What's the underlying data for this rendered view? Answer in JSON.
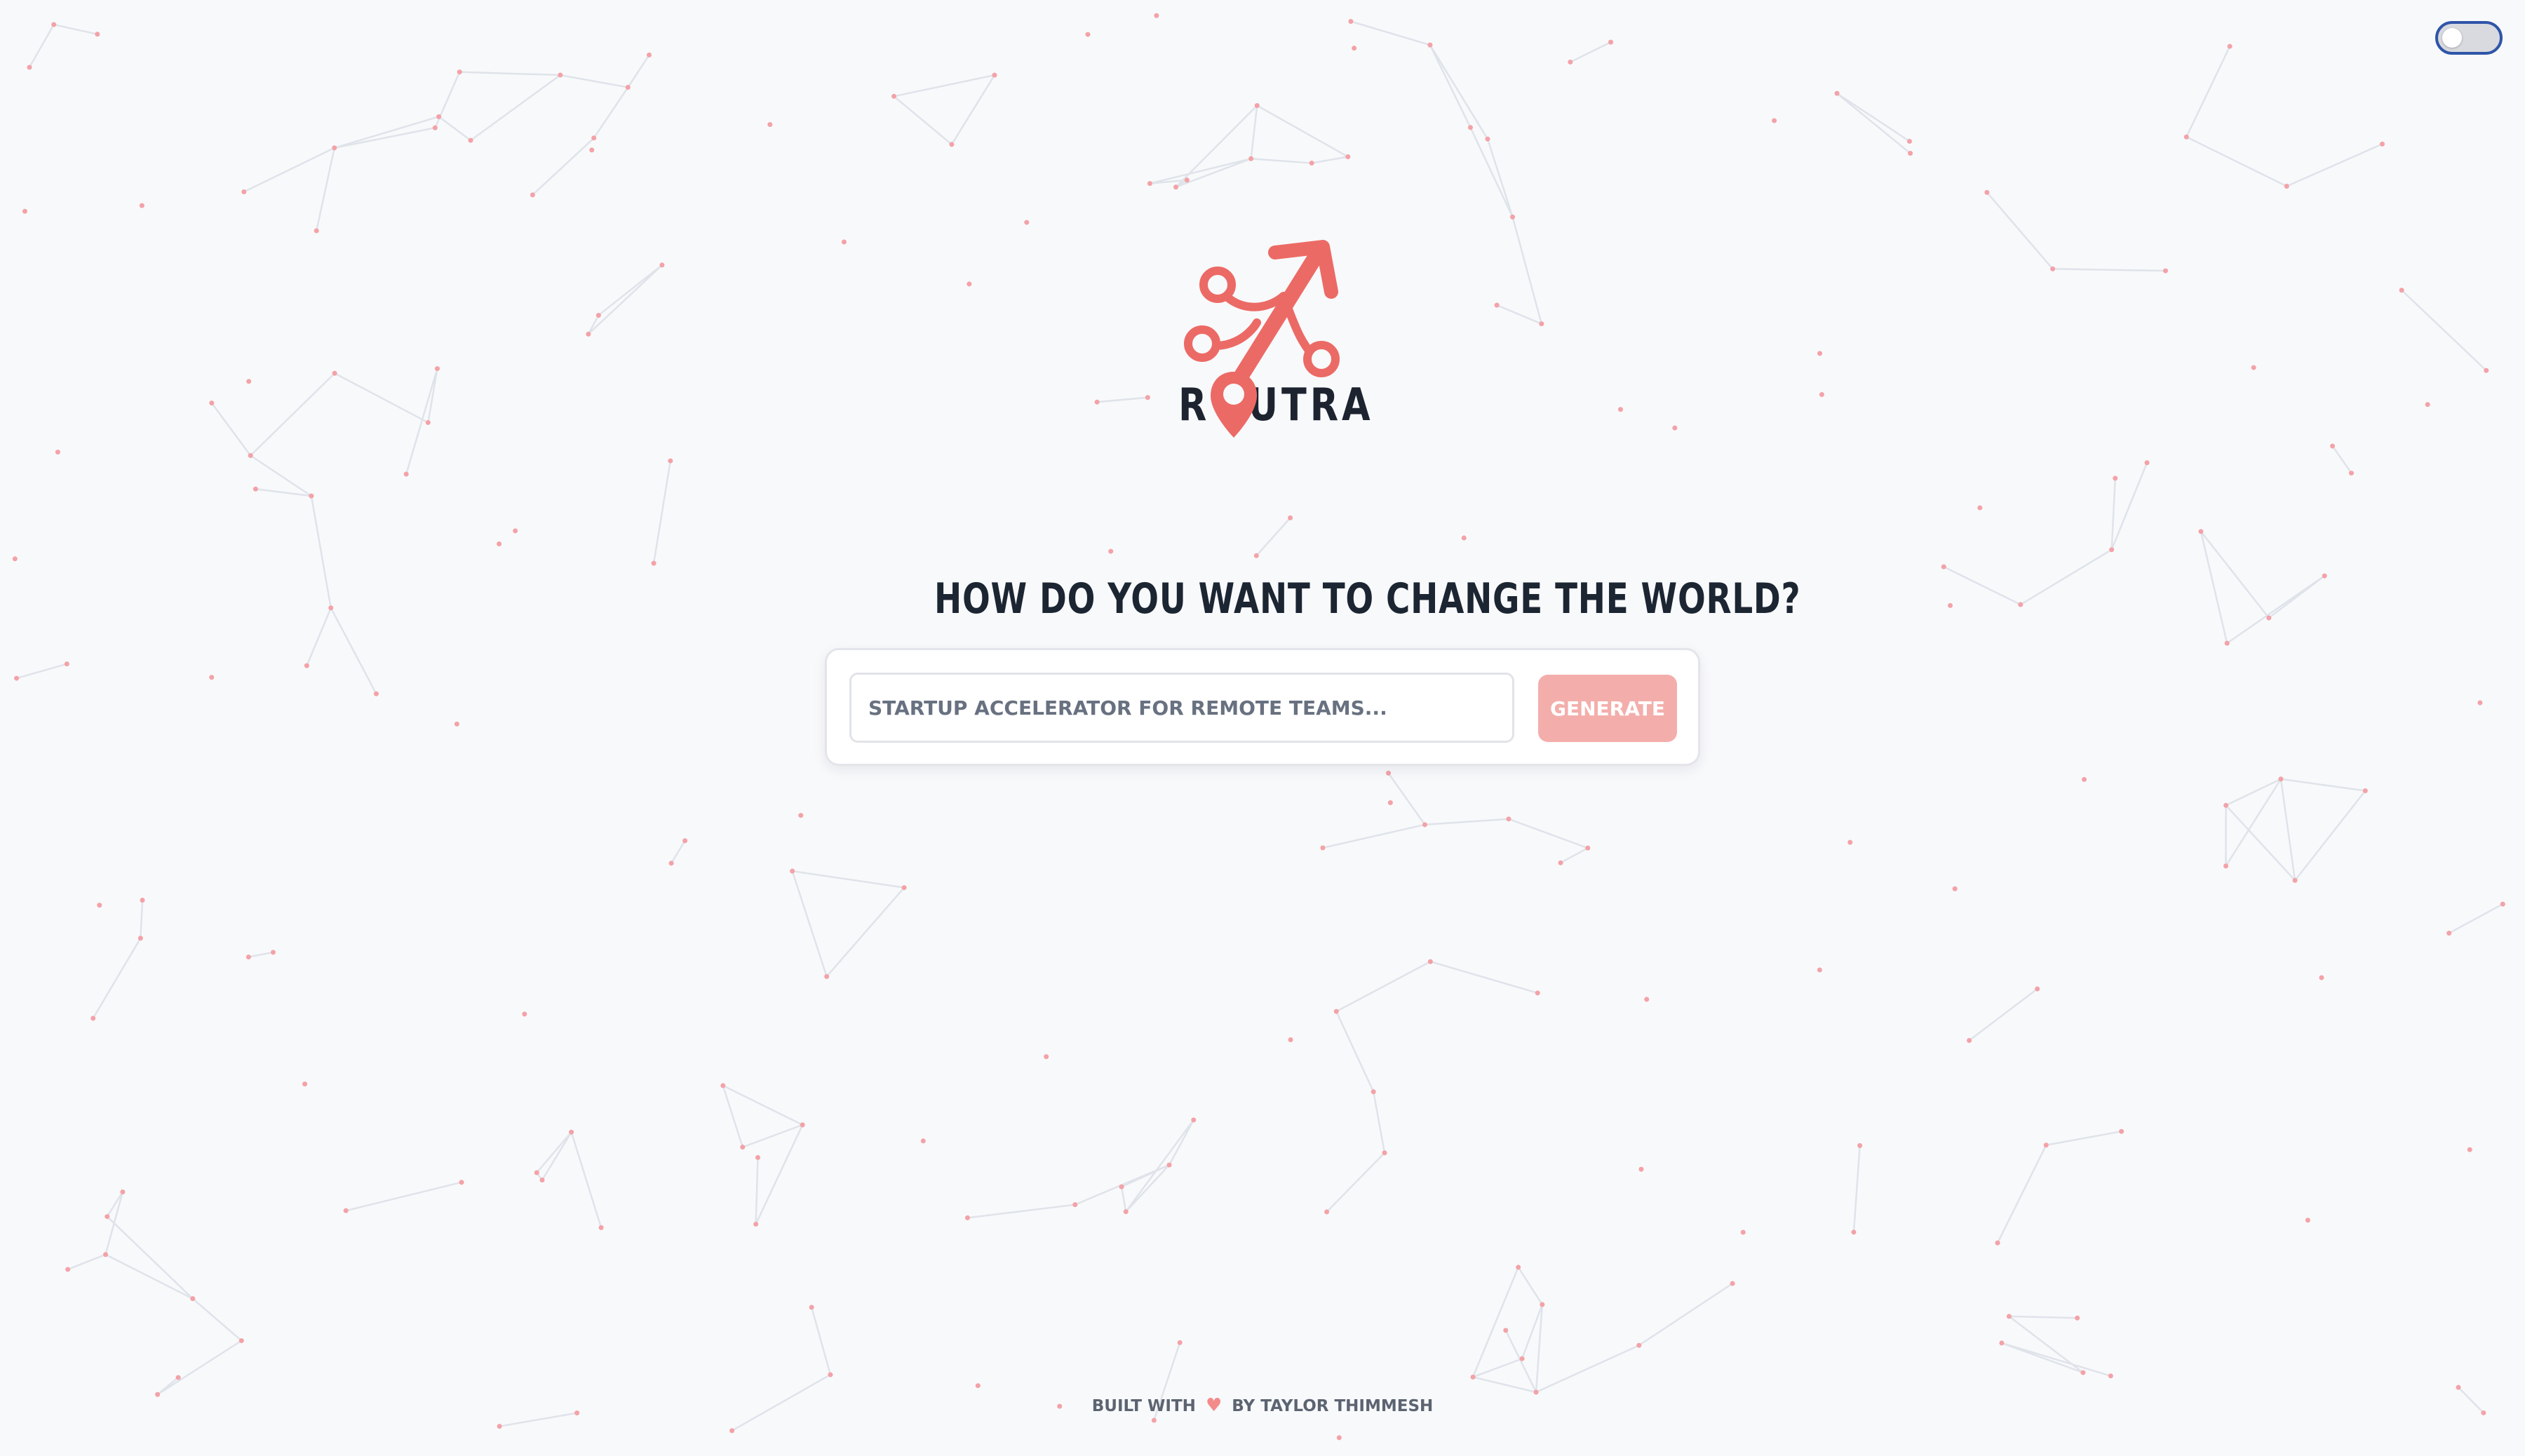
{
  "theme_toggle": {
    "state": "off"
  },
  "brand": {
    "wordmark": "ROUTRA",
    "accent_color": "#ec6a65"
  },
  "hero": {
    "headline": "HOW DO YOU WANT TO CHANGE THE WORLD?"
  },
  "search": {
    "input_value": "",
    "placeholder": "STARTUP ACCELERATOR FOR REMOTE TEAMS...",
    "button_label": "GENERATE",
    "button_color": "#f3aeab"
  },
  "footer": {
    "prefix": "BUILT WITH",
    "heart_icon": "heart-icon",
    "suffix": "BY TAYLOR THIMMESH"
  },
  "background": {
    "node_color": "#f3a2a7",
    "edge_color": "#dfe3ea",
    "pattern": "network-dots"
  }
}
